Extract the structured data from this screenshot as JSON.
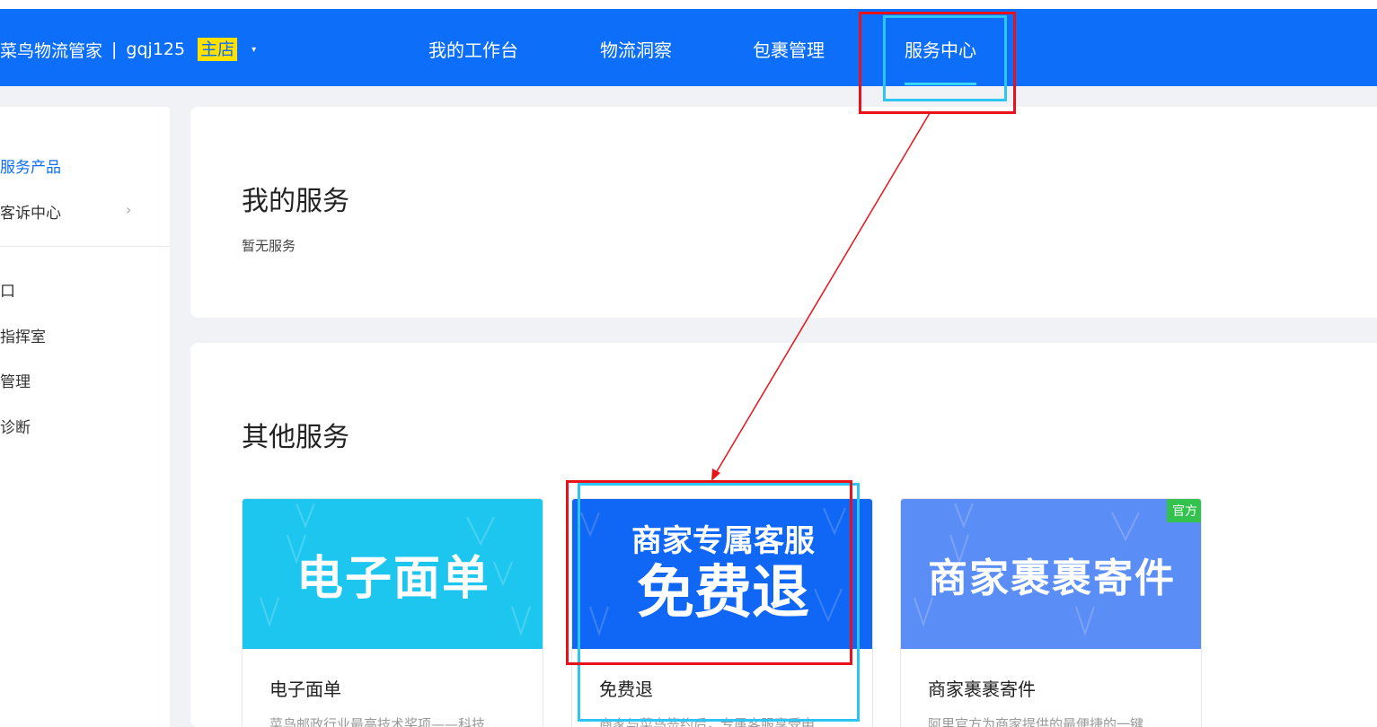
{
  "header": {
    "brand": "菜鸟物流管家",
    "separator": "|",
    "account": "gqj125",
    "store_badge": "主店",
    "dropdown_caret": "▾",
    "tabs": [
      {
        "label": "我的工作台",
        "active": false
      },
      {
        "label": "物流洞察",
        "active": false
      },
      {
        "label": "包裹管理",
        "active": false
      },
      {
        "label": "服务中心",
        "active": true
      }
    ]
  },
  "sidebar": {
    "items": [
      {
        "label": "服务产品",
        "active": true
      },
      {
        "label": "客诉中心",
        "active": false,
        "has_chevron": true
      },
      {
        "label": "口",
        "active": false
      },
      {
        "label": "指挥室",
        "active": false
      },
      {
        "label": "管理",
        "active": false
      },
      {
        "label": "诊断",
        "active": false
      }
    ],
    "chevron": "›"
  },
  "my_services": {
    "title": "我的服务",
    "empty_text": "暂无服务"
  },
  "other_services": {
    "title": "其他服务",
    "cards": [
      {
        "banner_text": "电子面单",
        "name": "电子面单",
        "desc": "菜鸟邮政行业最高技术奖项——科技",
        "banner_color": "#1cc6ef"
      },
      {
        "banner_sub": "商家专属客服",
        "banner_big": "免费退",
        "name": "免费退",
        "desc": "商家与菜鸟签约后，专属客服享受申",
        "banner_color": "#1167f5"
      },
      {
        "banner_text": "商家裹裹寄件",
        "tag": "官方",
        "name": "商家裹裹寄件",
        "desc": "阿里官方为商家提供的最便捷的一键",
        "banner_color": "#5a8df6",
        "tag_color": "#32c24d"
      }
    ]
  },
  "colors": {
    "primary": "#0d6ef9",
    "badge": "#ffe000",
    "annotation_red": "#e8131a",
    "annotation_cyan": "#2ec5f5"
  }
}
